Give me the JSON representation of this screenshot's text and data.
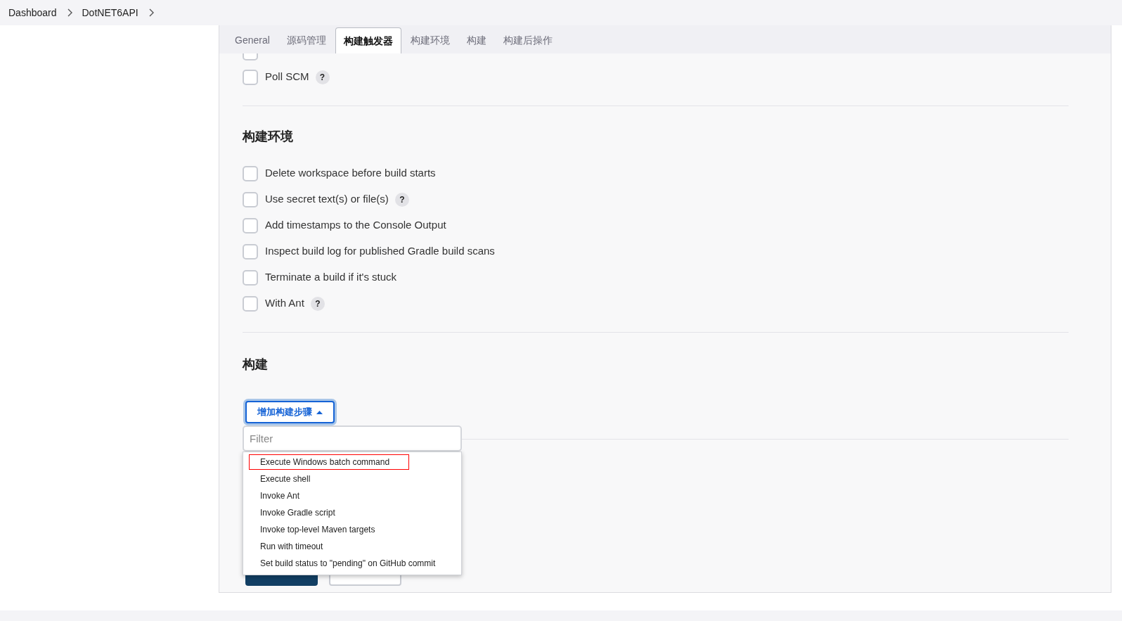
{
  "breadcrumb": [
    "Dashboard",
    "DotNET6API"
  ],
  "tabs": [
    {
      "label": "General",
      "selected": false
    },
    {
      "label": "源码管理",
      "selected": false
    },
    {
      "label": "构建触发器",
      "selected": true
    },
    {
      "label": "构建环境",
      "selected": false
    },
    {
      "label": "构建",
      "selected": false
    },
    {
      "label": "构建后操作",
      "selected": false
    }
  ],
  "cut_off_trigger": {
    "checked": false
  },
  "triggers": [
    {
      "label": "Poll SCM",
      "checked": false,
      "help": "?"
    }
  ],
  "build_environment": {
    "title": "构建环境",
    "options": [
      {
        "label": "Delete workspace before build starts",
        "checked": false
      },
      {
        "label": "Use secret text(s) or file(s)",
        "checked": false,
        "help": "?"
      },
      {
        "label": "Add timestamps to the Console Output",
        "checked": false
      },
      {
        "label": "Inspect build log for published Gradle build scans",
        "checked": false
      },
      {
        "label": "Terminate a build if it's stuck",
        "checked": false
      },
      {
        "label": "With Ant",
        "checked": false,
        "help": "?"
      }
    ]
  },
  "build": {
    "title": "构建",
    "add_step_button": "增加构建步骤",
    "menu_open": true,
    "filter": {
      "placeholder": "Filter"
    },
    "menu_items": [
      {
        "label": "Execute Windows batch command",
        "annotated": true
      },
      {
        "label": "Execute shell",
        "annotated": false
      },
      {
        "label": "Invoke Ant",
        "annotated": false
      },
      {
        "label": "Invoke Gradle script",
        "annotated": false
      },
      {
        "label": "Invoke top-level Maven targets",
        "annotated": false
      },
      {
        "label": "Run with timeout",
        "annotated": false
      },
      {
        "label": "Set build status to \"pending\" on GitHub commit",
        "annotated": false
      }
    ]
  }
}
